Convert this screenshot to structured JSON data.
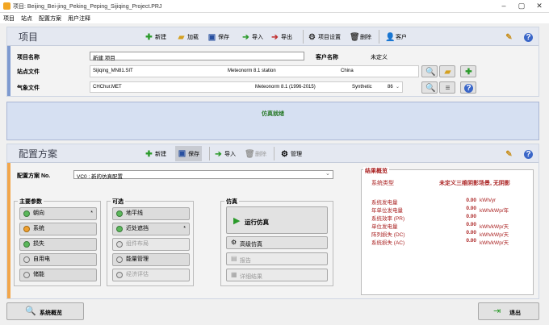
{
  "window": {
    "title": "项目: Beijing_Bei-jing_Peking_Peping_Sijiqing_Project.PRJ"
  },
  "menu": [
    "项目",
    "站点",
    "配置方案",
    "用户注释"
  ],
  "project": {
    "header": "项目",
    "toolbar": {
      "new": "新建",
      "load": "加载",
      "save": "保存",
      "import": "导入",
      "export": "导出",
      "settings": "项目设置",
      "delete": "删除",
      "client": "客户"
    },
    "name_label": "项目名称",
    "name_value": "新建 项目",
    "client_label": "客户名称",
    "client_value": "未定义",
    "site_label": "站点文件",
    "site_file": "Sijiqing_MN81.SIT",
    "site_source": "Meteonorm 8.1 station",
    "site_country": "China",
    "met_label": "气象文件",
    "met_file": "CHChur.MET",
    "met_source": "Meteonorm 8.1 (1996-2015)",
    "met_type": "Synthetic",
    "met_num": "86"
  },
  "status": "仿真就绪",
  "variant": {
    "header": "配置方案",
    "toolbar": {
      "new": "新建",
      "save": "保存",
      "import": "导入",
      "delete": "删除",
      "manage": "管理"
    },
    "no_label": "配置方案 No.",
    "no_value": "VC0    : 新的仿真配置",
    "main_title": "主要参数",
    "main": [
      "朝向",
      "系统",
      "损失",
      "自用电",
      "储能"
    ],
    "opt_title": "可选",
    "opt": [
      "地平线",
      "近处遮挡",
      "组件布局",
      "能量管理",
      "经济评估"
    ],
    "sim_title": "仿真",
    "run": "运行仿真",
    "adv": "高级仿真",
    "report": "报告",
    "detail": "详细结果"
  },
  "results": {
    "title": "结果概览",
    "type_label": "系统类型",
    "type_value": "未定义三维阴影场景, 无阴影",
    "rows": [
      {
        "label": "系统发电量",
        "value": "0.00",
        "unit": "kWh/yr"
      },
      {
        "label": "年单位发电量",
        "value": "0.00",
        "unit": "kWh/kWp/年"
      },
      {
        "label": "系统效率 (PR)",
        "value": "0.00",
        "unit": ""
      },
      {
        "label": "单位发电量",
        "value": "0.00",
        "unit": "kWh/kWp/天"
      },
      {
        "label": "阵列损失 (DC)",
        "value": "0.00",
        "unit": "kWh/kWp/天"
      },
      {
        "label": "系统损失 (AC)",
        "value": "0.00",
        "unit": "kWh/kWp/天"
      }
    ]
  },
  "footer": {
    "overview": "系统概览",
    "exit": "退出"
  }
}
